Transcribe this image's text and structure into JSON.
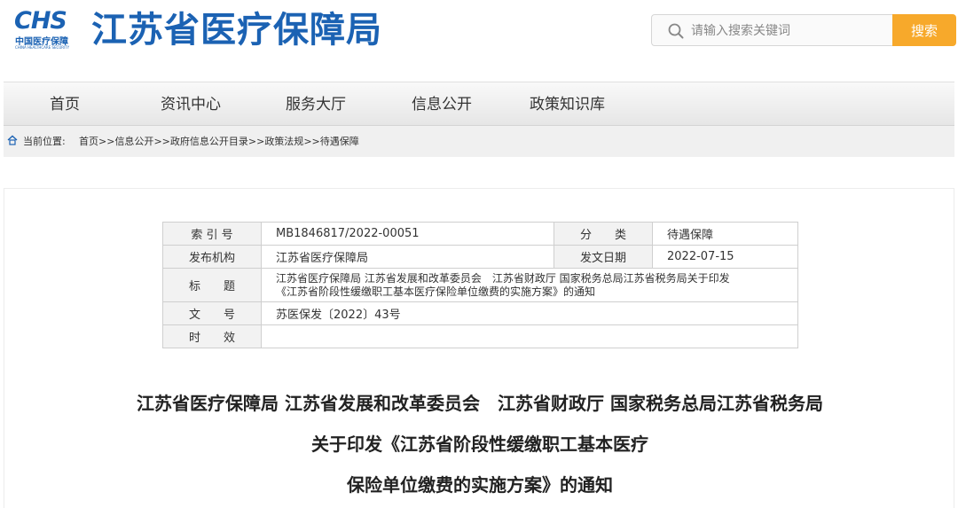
{
  "header": {
    "logo_mark": "CHS",
    "logo_cn": "中国医疗保障",
    "logo_en": "CHINA HEALTHCARE SECURITY",
    "site_title": "江苏省医疗保障局"
  },
  "search": {
    "placeholder": "请输入搜索关键词",
    "button_label": "搜索"
  },
  "nav": {
    "items": [
      "首页",
      "资讯中心",
      "服务大厅",
      "信息公开",
      "政策知识库"
    ]
  },
  "breadcrumb": {
    "label": "当前位置:",
    "items": [
      "首页",
      "信息公开",
      "政府信息公开目录",
      "政策法规",
      "待遇保障"
    ],
    "separator": ">>"
  },
  "meta": {
    "index_label": "索 引 号",
    "index_value": "MB1846817/2022-00051",
    "category_label": "分　　类",
    "category_value": "待遇保障",
    "publisher_label": "发布机构",
    "publisher_value": "江苏省医疗保障局",
    "date_label": "发文日期",
    "date_value": "2022-07-15",
    "title_label": "标　　题",
    "title_value_line1": "江苏省医疗保障局 江苏省发展和改革委员会　江苏省财政厅 国家税务总局江苏省税务局关于印发",
    "title_value_line2": "《江苏省阶段性缓缴职工基本医疗保险单位缴费的实施方案》的通知",
    "docno_label": "文　　号",
    "docno_value": "苏医保发〔2022〕43号",
    "validity_label": "时　　效",
    "validity_value": ""
  },
  "document": {
    "title_line1": "江苏省医疗保障局 江苏省发展和改革委员会　江苏省财政厅 国家税务总局江苏省税务局",
    "title_line2": "关于印发《江苏省阶段性缓缴职工基本医疗",
    "title_line3": "保险单位缴费的实施方案》的通知"
  },
  "colors": {
    "brand": "#1b62b3",
    "search_button": "#f7a92b"
  }
}
